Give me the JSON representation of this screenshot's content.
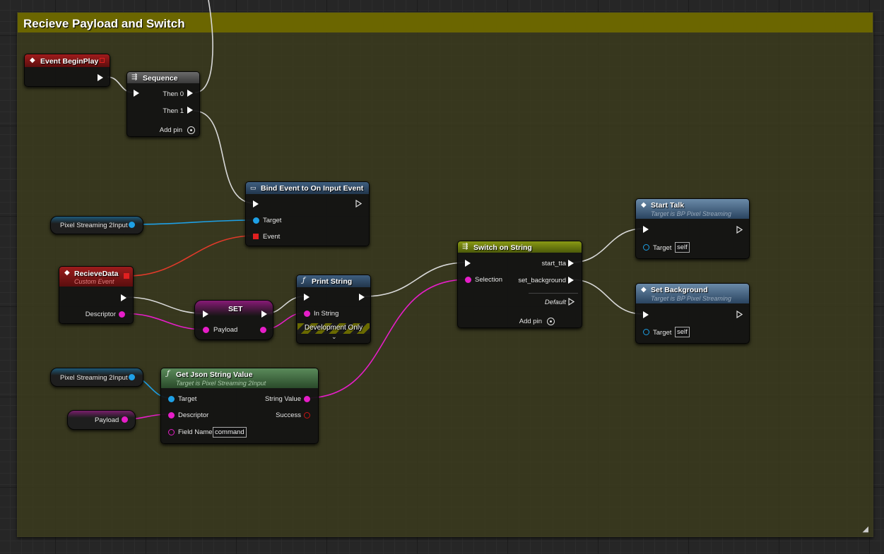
{
  "comment": {
    "title": "Recieve Payload and Switch"
  },
  "nodes": {
    "event_begin_play": {
      "title": "Event BeginPlay"
    },
    "sequence": {
      "title": "Sequence",
      "then0": "Then 0",
      "then1": "Then 1",
      "add_pin": "Add pin"
    },
    "bind_event": {
      "title": "Bind Event to On Input Event",
      "target": "Target",
      "event": "Event"
    },
    "pixel_streaming_input_1": {
      "label": "Pixel Streaming 2Input"
    },
    "recieve_data": {
      "title": "RecieveData",
      "subtitle": "Custom Event",
      "descriptor": "Descriptor"
    },
    "set": {
      "title": "SET",
      "payload": "Payload"
    },
    "print_string": {
      "title": "Print String",
      "in_string": "In String",
      "dev_only": "Development Only"
    },
    "switch_on_string": {
      "title": "Switch on String",
      "selection": "Selection",
      "case1": "start_tta",
      "case2": "set_background",
      "default": "Default",
      "add_pin": "Add pin"
    },
    "start_talk": {
      "title": "Start Talk",
      "subtitle": "Target is BP Pixel Streaming",
      "target": "Target",
      "target_value": "self"
    },
    "set_background": {
      "title": "Set Background",
      "subtitle": "Target is BP Pixel Streaming",
      "target": "Target",
      "target_value": "self"
    },
    "pixel_streaming_input_2": {
      "label": "Pixel Streaming 2Input"
    },
    "payload_getter": {
      "label": "Payload"
    },
    "get_json": {
      "title": "Get Json String Value",
      "subtitle": "Target is Pixel Streaming 2Input",
      "target": "Target",
      "descriptor": "Descriptor",
      "field_name": "Field Name",
      "field_value": "command",
      "string_value": "String Value",
      "success": "Success"
    }
  },
  "colors": {
    "exec_wire": "#d8d8d8",
    "object_pin": "#1ea0e6",
    "string_pin": "#e61ec8",
    "delegate_pin": "#e03a2a",
    "comment_bar": "#6b6600",
    "event_header": "#8a1414",
    "function_header": "#2a4a6a",
    "pure_header": "#3c6a3c",
    "switch_header": "#6a7a10"
  }
}
